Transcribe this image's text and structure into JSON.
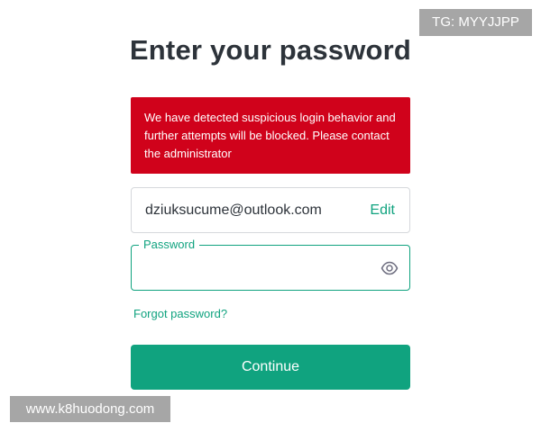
{
  "page": {
    "title": "Enter your password"
  },
  "alert": {
    "message": "We have detected suspicious login behavior and further attempts will be blocked. Please contact the administrator"
  },
  "email": {
    "value": "dziuksucume@outlook.com",
    "edit_label": "Edit"
  },
  "password": {
    "label": "Password",
    "value": "",
    "toggle_icon": "eye-icon"
  },
  "links": {
    "forgot_password": "Forgot password?"
  },
  "actions": {
    "continue_label": "Continue"
  },
  "overlays": {
    "tg_label": "TG: MYYJJPP",
    "site_label": "www.k8huodong.com"
  },
  "colors": {
    "accent": "#10a37f",
    "error": "#d0021b",
    "heading": "#2d333a",
    "overlay": "#a6a6a6"
  }
}
